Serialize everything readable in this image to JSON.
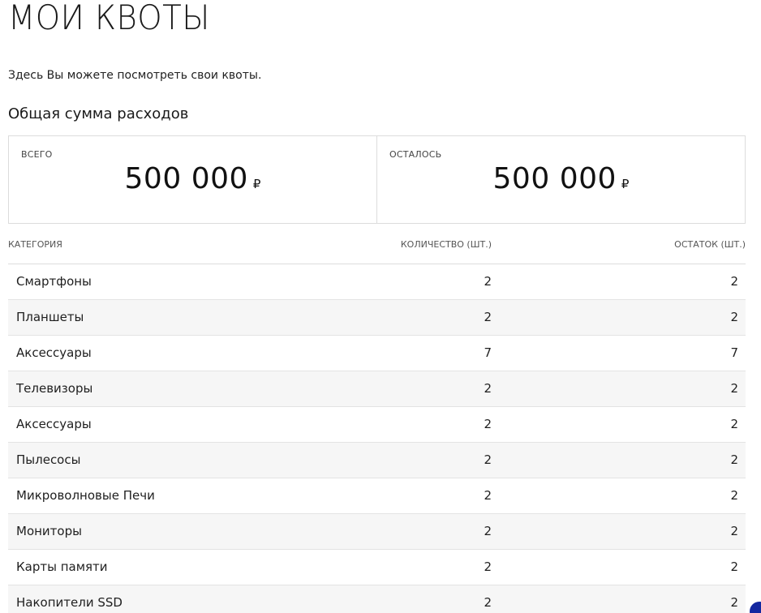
{
  "page": {
    "title": "МОИ КВОТЫ",
    "intro": "Здесь Вы можете посмотреть свои квоты."
  },
  "expenses": {
    "title": "Общая сумма расходов",
    "total": {
      "label": "ВСЕГО",
      "value": "500 000",
      "currency": "₽"
    },
    "remaining": {
      "label": "ОСТАЛОСЬ",
      "value": "500 000",
      "currency": "₽"
    }
  },
  "table": {
    "headers": {
      "category": "КАТЕГОРИЯ",
      "quantity": "КОЛИЧЕСТВО (ШТ.)",
      "remaining": "ОСТАТОК (ШТ.)"
    },
    "rows": [
      {
        "category": "Смартфоны",
        "quantity": "2",
        "remaining": "2"
      },
      {
        "category": "Планшеты",
        "quantity": "2",
        "remaining": "2"
      },
      {
        "category": "Аксессуары",
        "quantity": "7",
        "remaining": "7"
      },
      {
        "category": "Телевизоры",
        "quantity": "2",
        "remaining": "2"
      },
      {
        "category": "Аксессуары",
        "quantity": "2",
        "remaining": "2"
      },
      {
        "category": "Пылесосы",
        "quantity": "2",
        "remaining": "2"
      },
      {
        "category": "Микроволновые Печи",
        "quantity": "2",
        "remaining": "2"
      },
      {
        "category": "Мониторы",
        "quantity": "2",
        "remaining": "2"
      },
      {
        "category": "Карты памяти",
        "quantity": "2",
        "remaining": "2"
      },
      {
        "category": "Накопители SSD",
        "quantity": "2",
        "remaining": "2"
      }
    ]
  },
  "colors": {
    "accent": "#1428a0",
    "row_alt": "#f6f6f6",
    "border": "#dcdcdc"
  }
}
